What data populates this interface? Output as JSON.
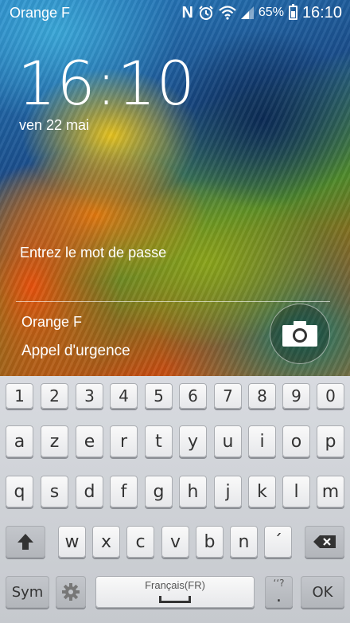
{
  "status_bar": {
    "carrier": "Orange F",
    "nfc": "N",
    "battery_percent": "65%",
    "time": "16:10",
    "icons": [
      "nfc-icon",
      "alarm-icon",
      "wifi-icon",
      "signal-icon",
      "battery-icon"
    ]
  },
  "lock_screen": {
    "time": "16:10",
    "date": "ven 22 mai",
    "password_prompt": "Entrez le mot de passe",
    "carrier": "Orange F",
    "emergency_call": "Appel d'urgence",
    "camera_icon": "camera-icon"
  },
  "keyboard": {
    "row_numbers": [
      "1",
      "2",
      "3",
      "4",
      "5",
      "6",
      "7",
      "8",
      "9",
      "0"
    ],
    "row1": [
      "a",
      "z",
      "e",
      "r",
      "t",
      "y",
      "u",
      "i",
      "o",
      "p"
    ],
    "row2": [
      "q",
      "s",
      "d",
      "f",
      "g",
      "h",
      "j",
      "k",
      "l",
      "m"
    ],
    "row3": [
      "w",
      "x",
      "c",
      "v",
      "b",
      "n",
      "´"
    ],
    "sym_label": "Sym",
    "space_language": "Français(FR)",
    "period_hint": "‘‘?",
    "period": ".",
    "ok_label": "OK",
    "shift_icon": "shift-icon",
    "backspace_icon": "backspace-icon",
    "settings_icon": "gear-icon"
  }
}
